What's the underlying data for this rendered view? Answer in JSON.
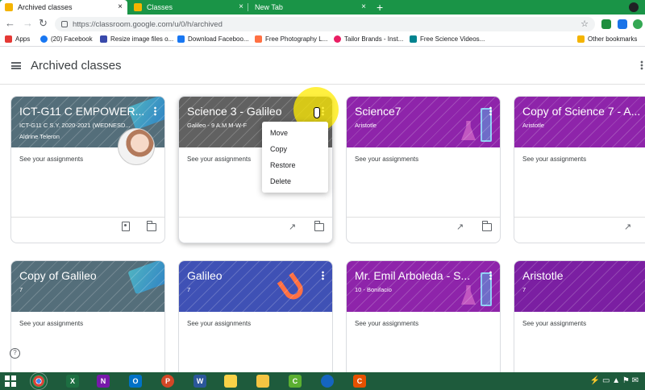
{
  "browser": {
    "tabs": [
      {
        "label": "Archived classes",
        "favicon_color": "#f4b400"
      },
      {
        "label": "Classes",
        "favicon_color": "#f4b400"
      },
      {
        "label": "New Tab",
        "favicon_color": ""
      }
    ],
    "new_tab_symbol": "+",
    "close_symbol": "×",
    "url": "https://classroom.google.com/u/0/h/archived",
    "bookmarks": [
      {
        "label": "Apps",
        "color": "#e53935"
      },
      {
        "label": "(20) Facebook",
        "color": "#1877f2"
      },
      {
        "label": "Resize image files o...",
        "color": "#3949ab"
      },
      {
        "label": "Download Faceboo...",
        "color": "#1877f2"
      },
      {
        "label": "Free Photography L...",
        "color": "#ff7043"
      },
      {
        "label": "Tailor Brands - Inst...",
        "color": "#e91e63"
      },
      {
        "label": "Free Science Videos...",
        "color": "#00838f"
      },
      {
        "label": "Other bookmarks",
        "color": "#f4b400"
      }
    ]
  },
  "header": {
    "title": "Archived classes"
  },
  "cards": [
    {
      "title": "ICT-G11 C EMPOWER...",
      "subtitle": "ICT-G11 C S.Y. 2020-2021 (WEDNESD...",
      "owner": "Aldrine Teleron",
      "assignments": "See your assignments",
      "color": "#546e7a"
    },
    {
      "title": "Science 3 - Galileo",
      "subtitle": "Galileo - 9 A.M M-W-F",
      "owner": "",
      "assignments": "See your assignments",
      "color": "#616161"
    },
    {
      "title": "Science7",
      "subtitle": "Aristotle",
      "owner": "",
      "assignments": "See your assignments",
      "color": "#8e24aa"
    },
    {
      "title": "Copy of Science 7 - A...",
      "subtitle": "Aristotle",
      "owner": "",
      "assignments": "See your assignments",
      "color": "#8e24aa"
    },
    {
      "title": "Copy of Galileo",
      "subtitle": "7",
      "owner": "",
      "assignments": "See your assignments",
      "color": "#546e7a"
    },
    {
      "title": "Galileo",
      "subtitle": "7",
      "owner": "",
      "assignments": "See your assignments",
      "color": "#3f51b5"
    },
    {
      "title": "Mr. Emil Arboleda - S...",
      "subtitle": "10 - Bonifacio",
      "owner": "",
      "assignments": "See your assignments",
      "color": "#8e24aa"
    },
    {
      "title": "Aristotle",
      "subtitle": "7",
      "owner": "",
      "assignments": "See your assignments",
      "color": "#7b1fa2"
    }
  ],
  "menu": {
    "items": [
      "Move",
      "Copy",
      "Restore",
      "Delete"
    ]
  },
  "help_symbol": "?",
  "taskbar": {
    "apps": [
      {
        "name": "chrome",
        "letter": "",
        "color": "#4caf50"
      },
      {
        "name": "excel",
        "letter": "X",
        "color": "#1d6f42"
      },
      {
        "name": "onenote",
        "letter": "N",
        "color": "#7719aa"
      },
      {
        "name": "outlook",
        "letter": "O",
        "color": "#0072c6"
      },
      {
        "name": "powerpoint",
        "letter": "P",
        "color": "#d24726"
      },
      {
        "name": "word",
        "letter": "W",
        "color": "#2b579a"
      },
      {
        "name": "file-explorer",
        "letter": "",
        "color": "#f9d247"
      },
      {
        "name": "folder",
        "letter": "",
        "color": "#f4c542"
      },
      {
        "name": "camtasia",
        "letter": "C",
        "color": "#5bb031"
      },
      {
        "name": "headset-app",
        "letter": "",
        "color": "#1565c0"
      },
      {
        "name": "camtasia-recorder",
        "letter": "C",
        "color": "#e65100"
      }
    ]
  }
}
